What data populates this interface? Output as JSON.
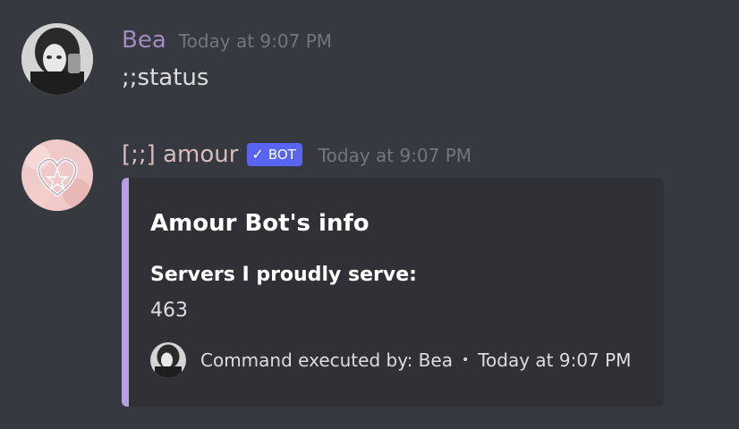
{
  "messages": [
    {
      "username": "Bea",
      "username_color": "#a38bbf",
      "timestamp": "Today at 9:07 PM",
      "avatar_icon": "user-photo-avatar",
      "content": ";;status"
    },
    {
      "username": "[;;] amour",
      "username_color": "#d9bcbc",
      "bot_badge": "BOT",
      "bot_badge_icon": "checkmark-icon",
      "timestamp": "Today at 9:07 PM",
      "avatar_icon": "heart-logo-avatar",
      "embed": {
        "accent_color": "#b79ee6",
        "title": "Amour Bot's info",
        "fields": [
          {
            "name": "Servers I proudly serve:",
            "value": "463"
          }
        ],
        "footer": {
          "text": "Command executed by: Bea",
          "separator": "•",
          "timestamp": "Today at 9:07 PM",
          "icon": "user-photo-avatar"
        }
      }
    }
  ]
}
